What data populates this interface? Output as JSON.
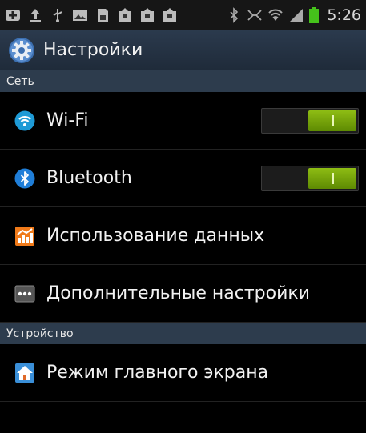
{
  "status_bar": {
    "time": "5:26",
    "icons": [
      "add-icon",
      "upload-icon",
      "usb-icon",
      "image-icon",
      "sd-card-icon",
      "notification-icon",
      "notification-icon",
      "notification-icon",
      "bluetooth-icon",
      "nfc-icon",
      "wifi-signal-icon",
      "cell-signal-icon",
      "battery-icon"
    ]
  },
  "header": {
    "title": "Настройки",
    "icon": "settings-gear-icon"
  },
  "sections": [
    {
      "label": "Сеть"
    },
    {
      "label": "Устройство"
    }
  ],
  "rows": {
    "wifi": {
      "label": "Wi-Fi",
      "icon": "wifi-icon",
      "toggle_on": true
    },
    "bluetooth": {
      "label": "Bluetooth",
      "icon": "bluetooth-icon",
      "toggle_on": true
    },
    "data_usage": {
      "label": "Использование данных",
      "icon": "data-usage-icon"
    },
    "more_settings": {
      "label": "Дополнительные настройки",
      "icon": "more-icon"
    },
    "home_screen": {
      "label": "Режим главного экрана",
      "icon": "home-screen-icon"
    }
  },
  "colors": {
    "accent_green": "#7cb211",
    "section_bg": "#2d3c4d",
    "wifi_blue": "#1e9ad6",
    "data_orange": "#f07a19"
  }
}
